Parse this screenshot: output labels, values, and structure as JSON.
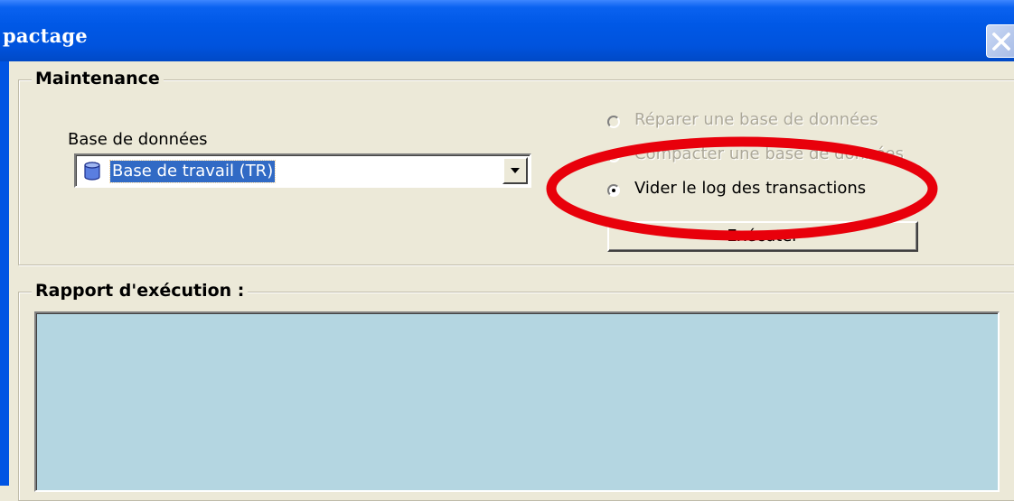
{
  "window": {
    "title": "pactage"
  },
  "maintenance": {
    "legend": "Maintenance",
    "database_label": "Base de données",
    "database_selected": "Base de travail (TR)",
    "options": [
      {
        "label": "Réparer une base de données",
        "enabled": false,
        "selected": false
      },
      {
        "label": "Compacter une base de données",
        "enabled": false,
        "selected": false
      },
      {
        "label": "Vider le log des transactions",
        "enabled": true,
        "selected": true
      }
    ],
    "execute_label": "Exécuter"
  },
  "report": {
    "legend": "Rapport d'exécution :"
  },
  "colors": {
    "titlebar": "#0058e6",
    "dialog": "#ece9d8",
    "selection": "#316ac5",
    "report_bg": "#b4d6e1",
    "annotation": "#e8000b"
  },
  "icons": {
    "close": "close-icon",
    "database": "database-icon",
    "dropdown": "chevron-down-icon"
  }
}
